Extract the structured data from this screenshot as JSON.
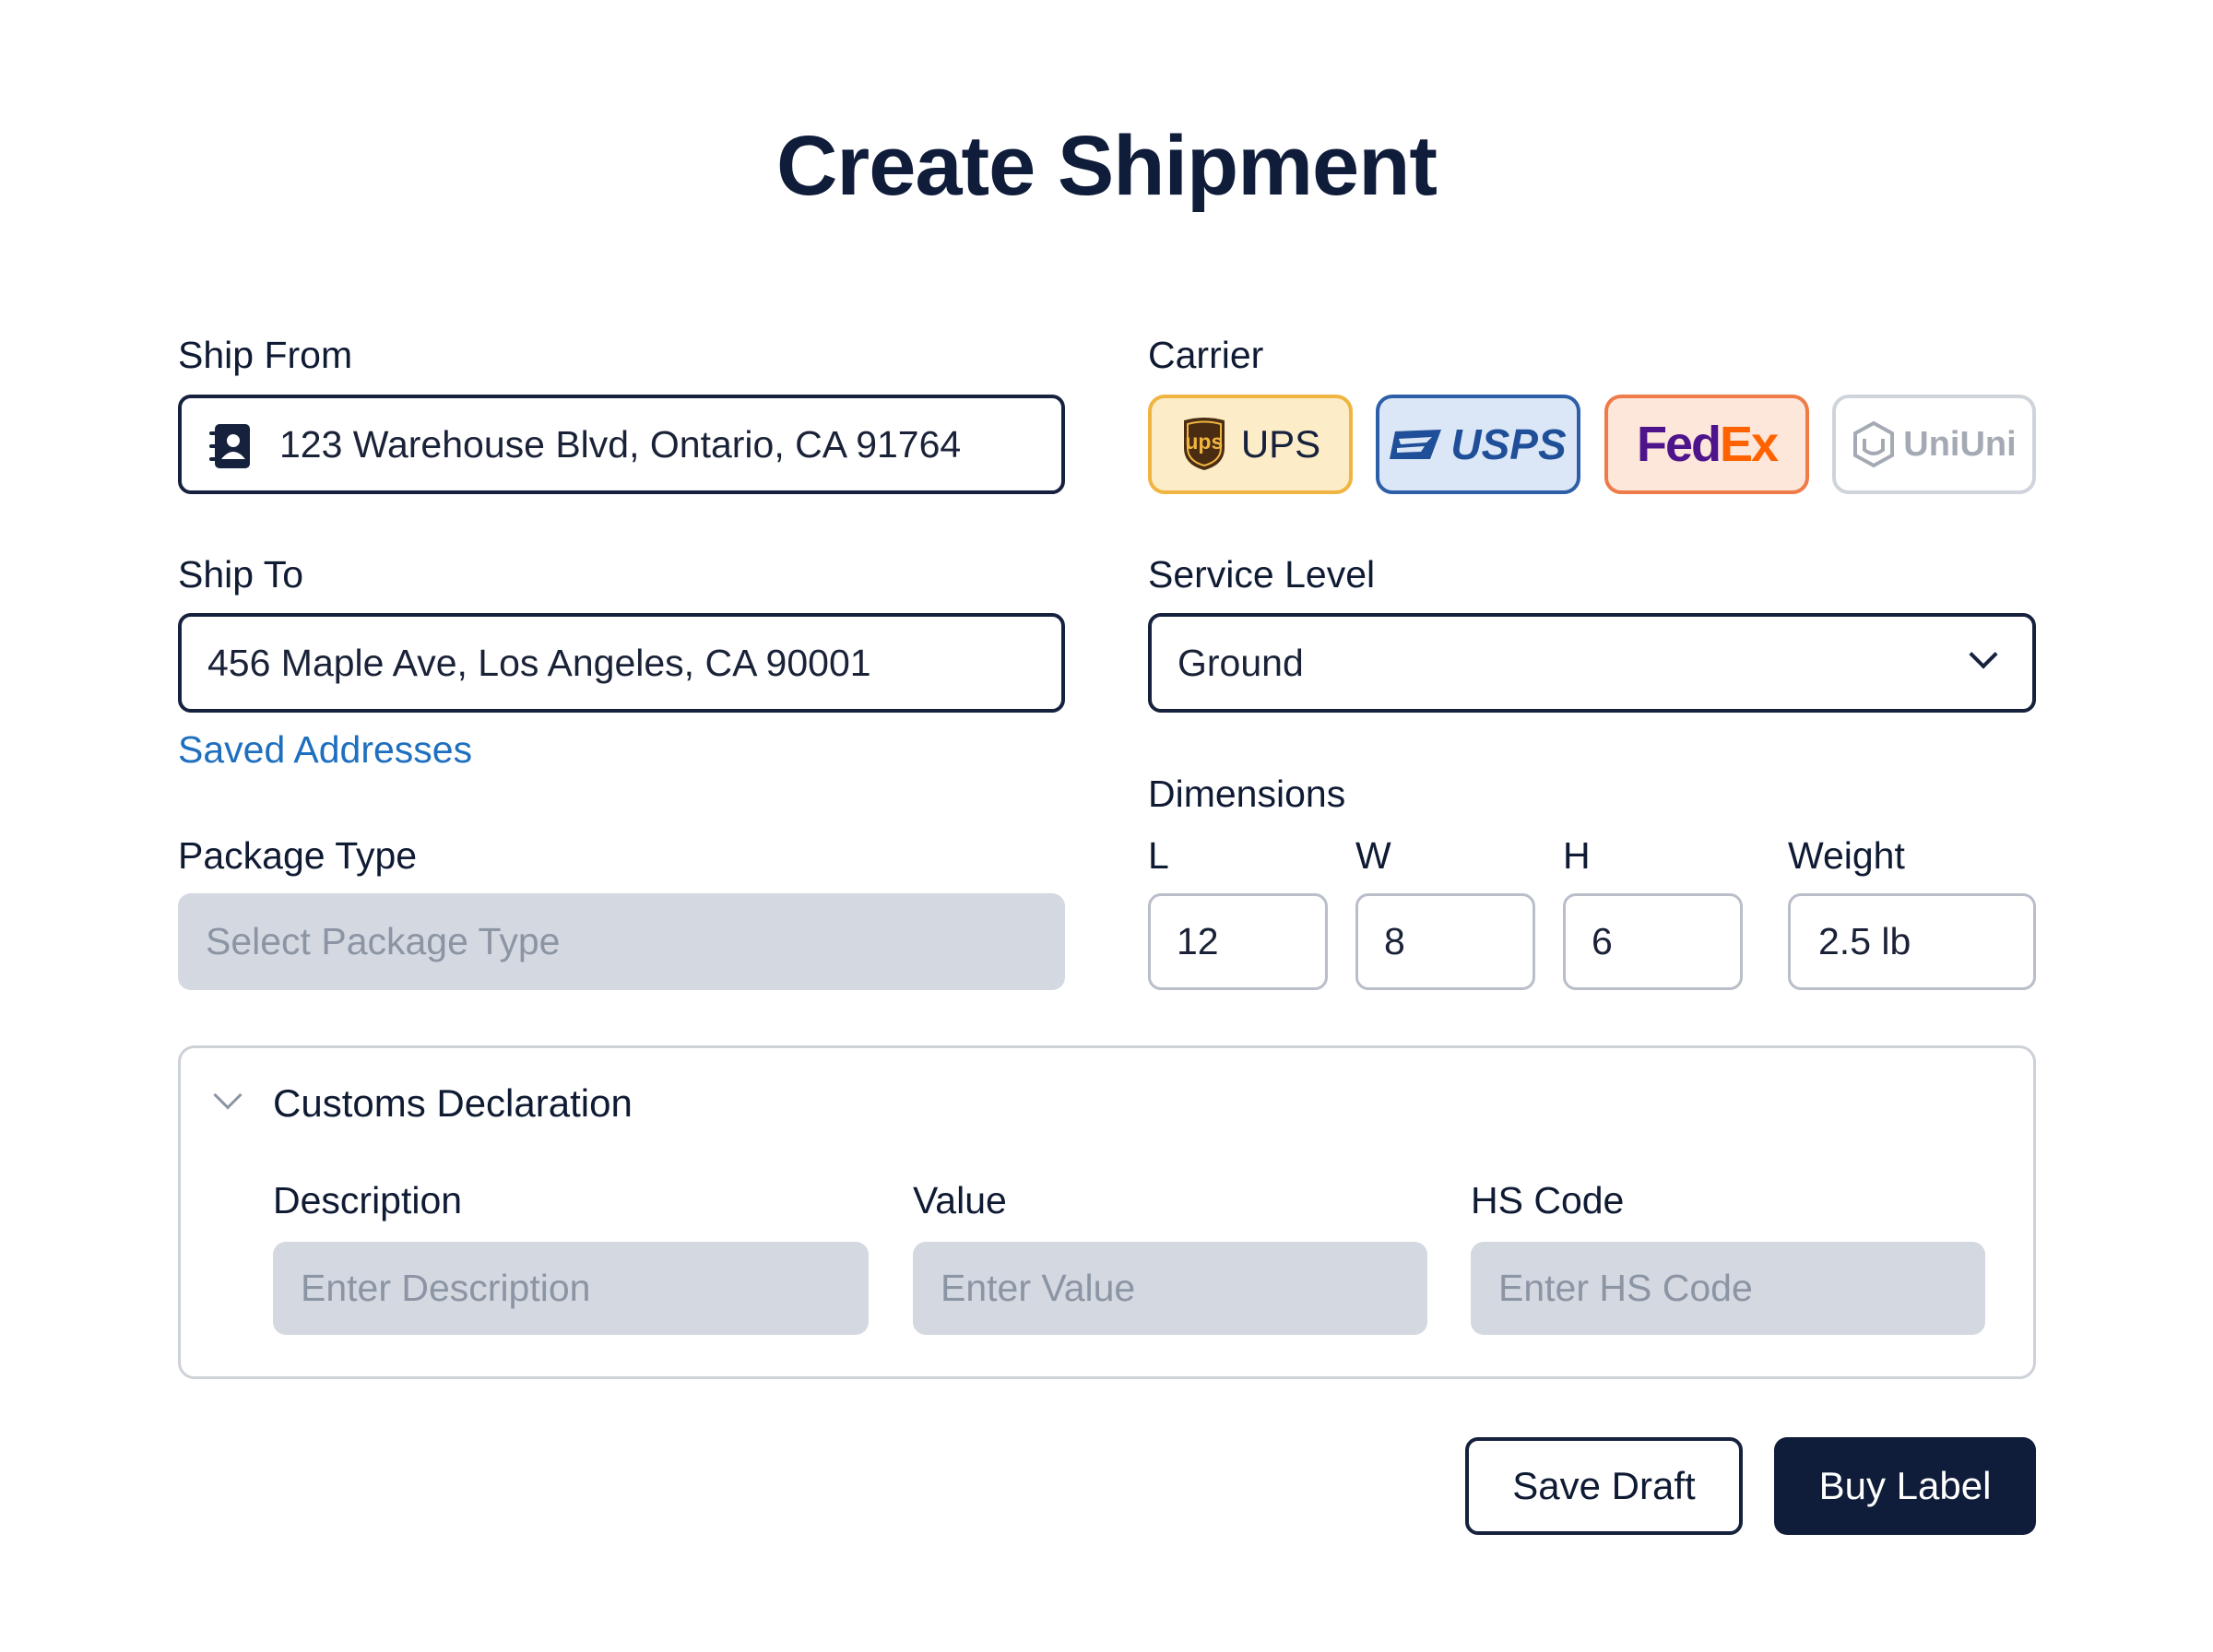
{
  "page": {
    "title": "Create Shipment"
  },
  "ship_from": {
    "label": "Ship From",
    "value": "123 Warehouse Blvd, Ontario, CA 91764"
  },
  "ship_to": {
    "label": "Ship To",
    "value": "456 Maple Ave, Los Angeles, CA 90001",
    "saved_link": "Saved Addresses"
  },
  "package_type": {
    "label": "Package Type",
    "placeholder": "Select Package Type"
  },
  "carrier": {
    "label": "Carrier",
    "options": [
      {
        "logo": "ups",
        "name": "UPS"
      },
      {
        "name": "USPS"
      },
      {
        "name_a": "Fed",
        "name_b": "Ex"
      },
      {
        "name": "UniUni"
      }
    ]
  },
  "service_level": {
    "label": "Service Level",
    "value": "Ground"
  },
  "dimensions": {
    "label": "Dimensions",
    "length": {
      "label": "L",
      "value": "12"
    },
    "width": {
      "label": "W",
      "value": "8"
    },
    "height": {
      "label": "H",
      "value": "6"
    }
  },
  "weight": {
    "label": "Weight",
    "value": "2.5 lb"
  },
  "customs": {
    "title": "Customs Declaration",
    "description": {
      "label": "Description",
      "placeholder": "Enter Description"
    },
    "value": {
      "label": "Value",
      "placeholder": "Enter Value"
    },
    "hs_code": {
      "label": "HS Code",
      "placeholder": "Enter HS Code"
    }
  },
  "actions": {
    "save_draft": "Save Draft",
    "buy_label": "Buy Label"
  },
  "colors": {
    "primary": "#0f1c3a",
    "link": "#1e6fbf",
    "ups_bg": "#fcecc8",
    "ups_border": "#f0b541",
    "usps_bg": "#dbe7f7",
    "usps_border": "#2d5ea8",
    "fedex_bg": "#fde6da",
    "fedex_border": "#ee7b48",
    "fedex_purple": "#4d148c",
    "fedex_orange": "#ff6200"
  }
}
